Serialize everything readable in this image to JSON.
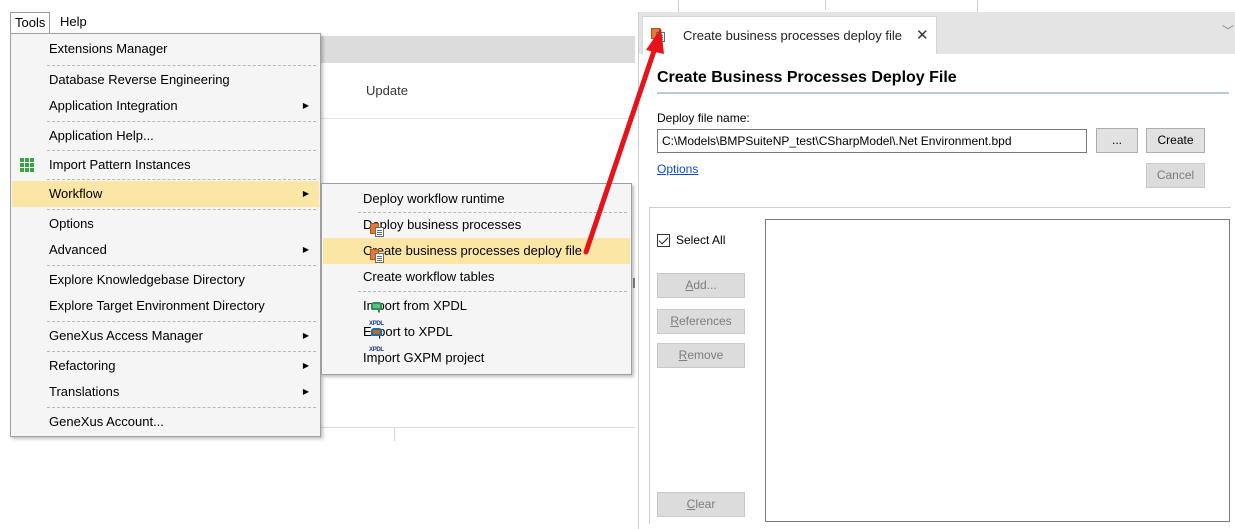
{
  "menubar": {
    "tools": "Tools",
    "help": "Help"
  },
  "background": {
    "update_label": "Update"
  },
  "tools_menu": {
    "items": [
      {
        "label": "Extensions Manager"
      },
      {
        "label": "Database Reverse Engineering"
      },
      {
        "label": "Application Integration"
      },
      {
        "label": "Application Help..."
      },
      {
        "label": "Import Pattern Instances"
      },
      {
        "label": "Workflow"
      },
      {
        "label": "Options"
      },
      {
        "label": "Advanced"
      },
      {
        "label": "Explore Knowledgebase Directory"
      },
      {
        "label": "Explore Target Environment Directory"
      },
      {
        "label": "GeneXus Access Manager"
      },
      {
        "label": "Refactoring"
      },
      {
        "label": "Translations"
      },
      {
        "label": "GeneXus Account..."
      }
    ]
  },
  "workflow_menu": {
    "items": [
      {
        "label": "Deploy workflow runtime"
      },
      {
        "label": "Deploy business processes"
      },
      {
        "label": "Create business processes deploy file"
      },
      {
        "label": "Create workflow tables"
      },
      {
        "label": "Import from XPDL"
      },
      {
        "label": "Export to XPDL"
      },
      {
        "label": "Import GXPM project"
      }
    ]
  },
  "panel": {
    "tab_title": "Create business processes deploy file",
    "heading": "Create Business Processes Deploy File",
    "deploy_file_label": "Deploy file name:",
    "deploy_file_value": "C:\\Models\\BMPSuiteNP_test\\CSharpModel\\.Net Environment.bpd",
    "browse_label": "...",
    "create_label": "Create",
    "cancel_label": "Cancel",
    "options_link": "Options",
    "select_all_label": "Select All",
    "add_label_first": "A",
    "add_label_rest": "dd...",
    "refs_label_first": "R",
    "refs_label_rest": "eferences",
    "remove_label_first": "R",
    "remove_label_rest": "emove",
    "clear_label_first": "C",
    "clear_label_rest": "lear"
  },
  "colors": {
    "highlight": "#fbe6a6",
    "arrow": "#e8131a",
    "link": "#0a4fc9"
  }
}
